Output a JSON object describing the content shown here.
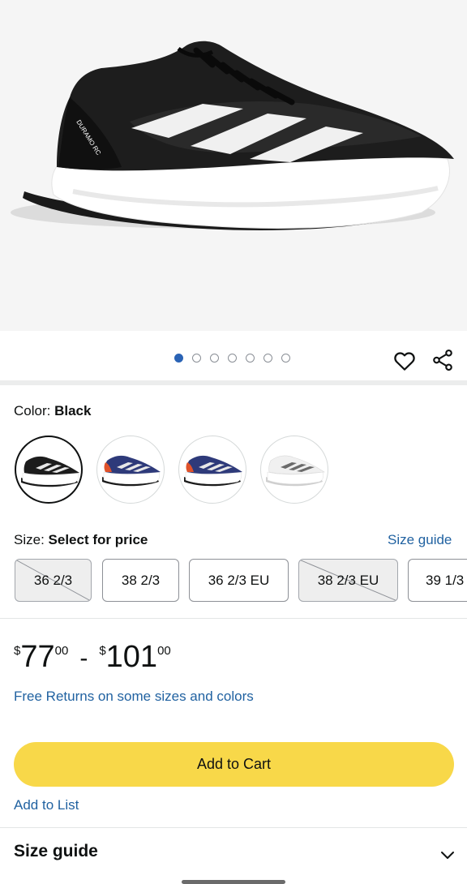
{
  "gallery": {
    "dot_count": 7,
    "active_index": 0,
    "icons": {
      "wishlist": "heart-icon",
      "share": "share-icon"
    }
  },
  "color": {
    "label": "Color:",
    "selected": "Black",
    "swatches": [
      {
        "name": "black-white",
        "colors": {
          "upper": "#1c1c1c",
          "sole": "#ffffff",
          "stripes": "#e8e8e8"
        }
      },
      {
        "name": "navy-red",
        "colors": {
          "upper": "#2e3a7a",
          "sole": "#ffffff",
          "heel": "#e0522b",
          "stripes": "#e8e8e8"
        }
      },
      {
        "name": "navy-red-2",
        "colors": {
          "upper": "#2e3a7a",
          "sole": "#ffffff",
          "heel": "#e0522b",
          "stripes": "#e8e8e8"
        }
      },
      {
        "name": "white-grey",
        "colors": {
          "upper": "#f2f2f2",
          "sole": "#ffffff",
          "stripes": "#6a6a6a"
        }
      }
    ]
  },
  "size": {
    "label": "Size:",
    "prompt": "Select for price",
    "guide_link": "Size guide",
    "options": [
      {
        "label": "36 2/3",
        "available": false
      },
      {
        "label": "38 2/3",
        "available": true
      },
      {
        "label": "36 2/3 EU",
        "available": true
      },
      {
        "label": "38 2/3 EU",
        "available": false
      },
      {
        "label": "39 1/3",
        "available": true
      }
    ]
  },
  "price": {
    "symbol": "$",
    "low_whole": "77",
    "low_frac": "00",
    "separator": "-",
    "high_whole": "101",
    "high_frac": "00"
  },
  "free_returns": "Free Returns on some sizes and colors",
  "add_to_cart": "Add to Cart",
  "add_to_list": "Add to List",
  "size_guide_section": {
    "title": "Size guide",
    "icon": "chevron-down-icon"
  },
  "colors": {
    "link": "#2162a1",
    "cart_button": "#f8d849",
    "active_dot": "#2a63b5"
  }
}
